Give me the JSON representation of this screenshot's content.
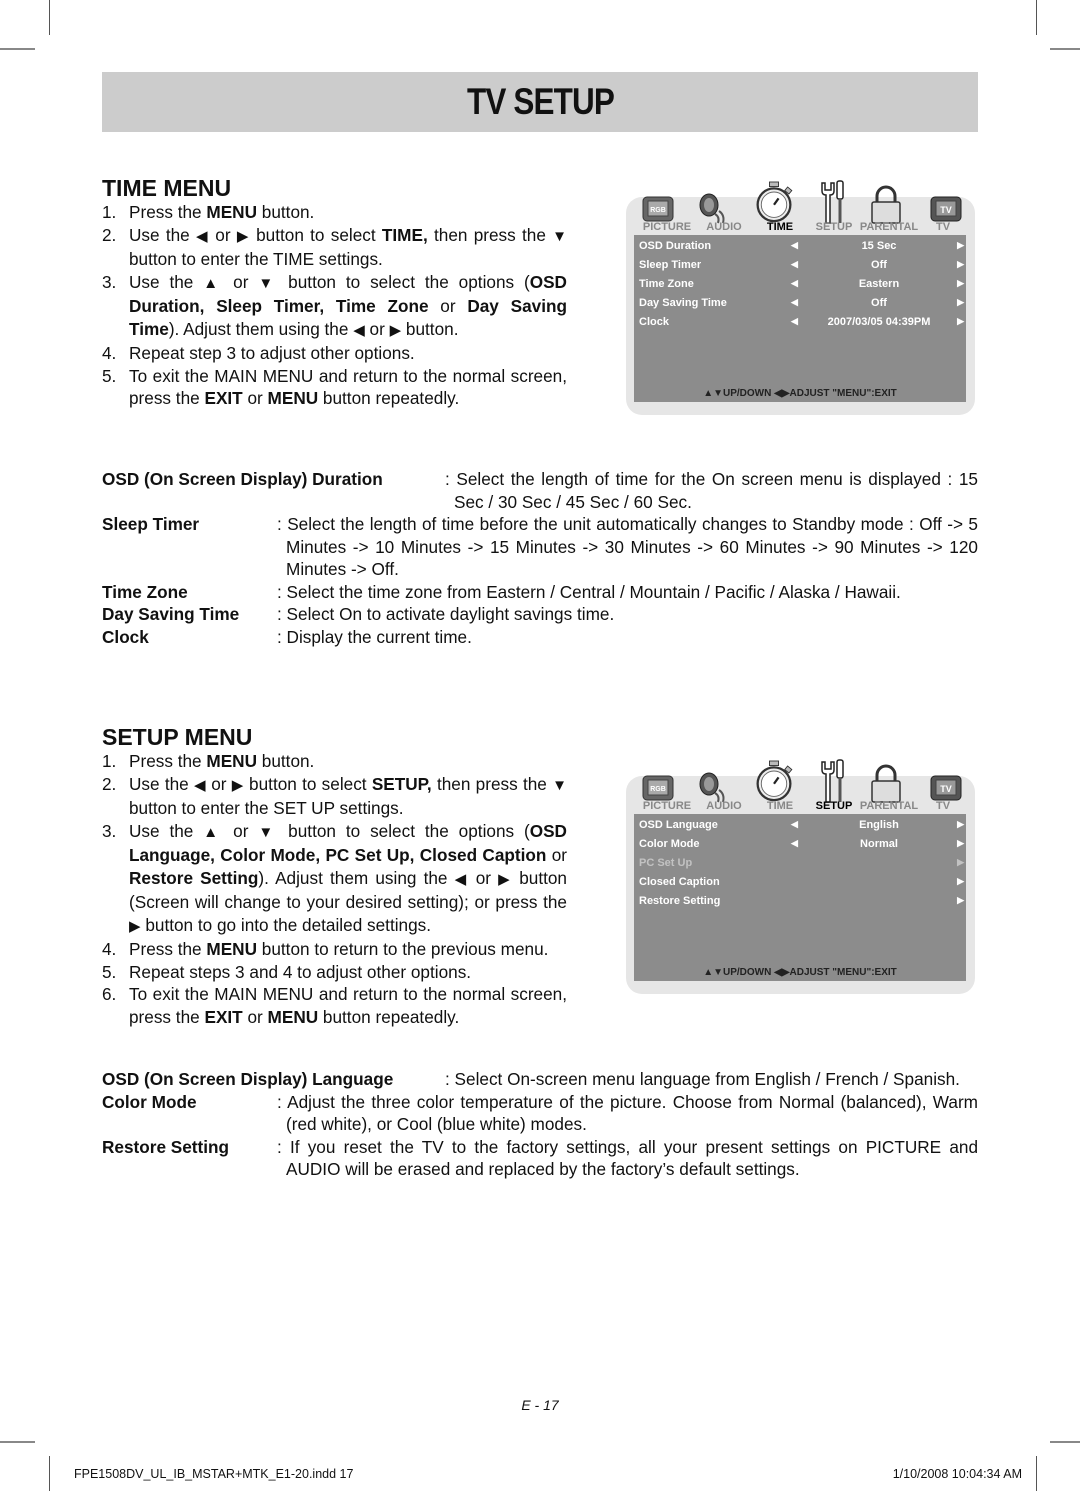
{
  "header": {
    "title": "TV SETUP"
  },
  "time_menu": {
    "title": "TIME MENU",
    "steps": [
      {
        "num": "1.",
        "parts": [
          "Press the ",
          "MENU",
          " button."
        ]
      },
      {
        "num": "2.",
        "parts": [
          "Use the ",
          "◀",
          " or ",
          "▶",
          " button to select ",
          "TIME,",
          " then press the ",
          "▼",
          " button to enter the TIME settings."
        ]
      },
      {
        "num": "3.",
        "parts": [
          "Use the ",
          "▲",
          " or ",
          "▼",
          " button to select the options (",
          "OSD Duration, Sleep Timer, Time Zone",
          " or ",
          "Day Saving Time",
          "). Adjust them using the ",
          "◀",
          " or ",
          "▶",
          " button."
        ]
      },
      {
        "num": "4.",
        "parts": [
          "Repeat step 3 to adjust other options."
        ]
      },
      {
        "num": "5.",
        "parts": [
          "To exit the MAIN MENU and return to the normal screen, press the ",
          "EXIT",
          " or ",
          "MENU",
          " button repeatedly."
        ]
      }
    ],
    "osd": {
      "tabs": [
        "PICTURE",
        "AUDIO",
        "TIME",
        "SETUP",
        "PARENTAL",
        "TV"
      ],
      "active_tab": "TIME",
      "icons": [
        "picture-rgb-icon",
        "audio-speaker-icon",
        "time-stopwatch-icon",
        "setup-tools-icon",
        "parental-lock-icon",
        "tv-icon"
      ],
      "rows": [
        {
          "label": "OSD Duration",
          "value": "15 Sec",
          "left_arrow": "◀",
          "right_arrow": "▶",
          "enabled": true
        },
        {
          "label": "Sleep Timer",
          "value": "Off",
          "left_arrow": "◀",
          "right_arrow": "▶",
          "enabled": true
        },
        {
          "label": "Time Zone",
          "value": "Eastern",
          "left_arrow": "◀",
          "right_arrow": "▶",
          "enabled": true
        },
        {
          "label": "Day Saving Time",
          "value": "Off",
          "left_arrow": "◀",
          "right_arrow": "▶",
          "enabled": true
        },
        {
          "label": "Clock",
          "value": "2007/03/05 04:39PM",
          "left_arrow": "◀",
          "right_arrow": "▶",
          "enabled": true
        }
      ],
      "footer": "▲▼UP/DOWN  ◀▶ADJUST  \"MENU\":EXIT"
    },
    "definitions": [
      {
        "term": "OSD (On Screen Display) Duration",
        "desc": ": Select the length of time for the On screen menu is displayed : 15 Sec / 30 Sec / 45 Sec / 60 Sec."
      },
      {
        "term": "Sleep Timer",
        "desc": ": Select the length of time before the unit automatically changes to Standby mode : Off -> 5 Minutes  -> 10 Minutes -> 15 Minutes -> 30 Minutes -> 60 Minutes -> 90 Minutes -> 120 Minutes  -> Off."
      },
      {
        "term": "Time Zone",
        "desc": ": Select the time zone from Eastern / Central / Mountain /  Pacific  / Alaska / Hawaii."
      },
      {
        "term": "Day Saving Time",
        "desc": ": Select On to activate daylight savings time."
      },
      {
        "term": "Clock",
        "desc": ": Display the current time."
      }
    ]
  },
  "setup_menu": {
    "title": "SETUP MENU",
    "steps": [
      {
        "num": "1.",
        "parts": [
          "Press the ",
          "MENU",
          " button."
        ]
      },
      {
        "num": "2.",
        "parts": [
          "Use the ",
          "◀",
          " or ",
          "▶",
          " button to select ",
          "SETUP,",
          " then press the ",
          "▼",
          " button to enter the SET UP settings."
        ]
      },
      {
        "num": "3.",
        "parts": [
          "Use the ",
          "▲",
          " or ",
          "▼",
          " button to select the options (",
          "OSD Language, Color Mode, PC Set Up, Closed Caption",
          " or ",
          "Restore Setting",
          "). Adjust them using the ",
          "◀",
          " or ",
          "▶",
          " button (Screen will change to your desired setting); or press the ",
          "▶",
          " button to go into the detailed settings."
        ]
      },
      {
        "num": "4.",
        "parts": [
          "Press the ",
          "MENU",
          " button to return to the previous menu."
        ]
      },
      {
        "num": "5.",
        "parts": [
          "Repeat steps 3 and 4 to adjust other options."
        ]
      },
      {
        "num": "6.",
        "parts": [
          "To exit the MAIN MENU and return to the normal screen, press the ",
          "EXIT",
          " or ",
          "MENU",
          " button repeatedly."
        ]
      }
    ],
    "osd": {
      "tabs": [
        "PICTURE",
        "AUDIO",
        "TIME",
        "SETUP",
        "PARENTAL",
        "TV"
      ],
      "active_tab": "SETUP",
      "icons": [
        "picture-rgb-icon",
        "audio-speaker-icon",
        "time-stopwatch-icon",
        "setup-tools-icon",
        "parental-lock-icon",
        "tv-icon"
      ],
      "rows": [
        {
          "label": "OSD Language",
          "value": "English",
          "left_arrow": "◀",
          "right_arrow": "▶",
          "enabled": true
        },
        {
          "label": "Color Mode",
          "value": "Normal",
          "left_arrow": "◀",
          "right_arrow": "▶",
          "enabled": true
        },
        {
          "label": "PC Set Up",
          "value": "",
          "left_arrow": "",
          "right_arrow": "▶",
          "enabled": false
        },
        {
          "label": "Closed Caption",
          "value": "",
          "left_arrow": "",
          "right_arrow": "▶",
          "enabled": true
        },
        {
          "label": "Restore Setting",
          "value": "",
          "left_arrow": "",
          "right_arrow": "▶",
          "enabled": true
        }
      ],
      "footer": "▲▼UP/DOWN  ◀▶ADJUST  \"MENU\":EXIT"
    },
    "definitions": [
      {
        "term": "OSD (On Screen Display) Language",
        "desc": ": Select On-screen menu language from English / French / Spanish."
      },
      {
        "term": "Color  Mode",
        "desc": ": Adjust the three color temperature of the picture. Choose from Normal (balanced), Warm (red white), or Cool (blue white) modes."
      },
      {
        "term": "Restore Setting",
        "desc": ": If you reset the TV to the factory settings, all your present settings on PICTURE and AUDIO will be erased and replaced by the factory’s default settings."
      }
    ]
  },
  "footer": {
    "page_number": "E - 17",
    "file_name": "FPE1508DV_UL_IB_MSTAR+MTK_E1-20.indd   17",
    "timestamp": "1/10/2008   10:04:34 AM"
  }
}
